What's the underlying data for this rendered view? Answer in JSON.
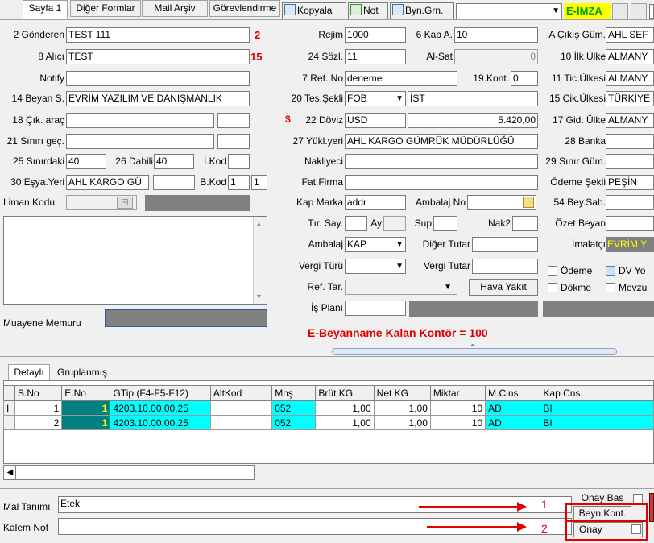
{
  "tabs": [
    "Sayfa 1",
    "Diğer Formlar",
    "Mail Arşiv",
    "Görevlendirme"
  ],
  "toolbar": {
    "kopyala": "Kopyala",
    "not": "Not",
    "byngrn": "Byn.Grn.",
    "eimza": "E-İMZA"
  },
  "colors": {
    "eimza_bg": "#ffff00",
    "eimza_fg": "#00a000",
    "red": "#e00000",
    "cyan": "#00ffff",
    "teal": "#008080"
  },
  "left": {
    "gonderen_label": "2 Gönderen",
    "gonderen_value": "TEST 111",
    "gonderen_num": "2",
    "alici_label": "8 Alıcı",
    "alici_value": "TEST",
    "alici_num": "15",
    "notify_label": "Notify",
    "beyan_label": "14 Beyan S.",
    "beyan_value": "EVRİM YAZILIM VE DANIŞMANLIK",
    "cik_arac_label": "18 Çık. araç",
    "sinir_gec_label": "21 Sınırı geç.",
    "sinirdaki_label": "25 Sınırdaki",
    "sinirdaki_value": "40",
    "dahili_label": "26 Dahili",
    "dahili_value": "40",
    "ikod_label": "İ.Kod",
    "esya_label": "30 Eşya.Yeri",
    "esya_value": "AHL KARGO GÜ",
    "bkod_label": "B.Kod",
    "bkod_value1": "1",
    "bkod_value2": "1",
    "liman_label": "Liman Kodu",
    "muayene_label": "Muayene Memuru"
  },
  "middle": {
    "rejim_label": "Rejim",
    "rejim_value": "1000",
    "kapa_label": "6 Kap A.",
    "kapa_value": "10",
    "sozl_label": "24 Sözl.",
    "sozl_value": "11",
    "alsat_label": "Al-Sat",
    "alsat_value": "0",
    "refno_label": "7 Ref. No",
    "refno_value": "deneme",
    "kont_label": "19.Kont.",
    "kont_value": "0",
    "tes_label": "20 Tes.Şekli",
    "tes_value": "FOB",
    "tes_value2": "İST",
    "doviz_label": "22 Döviz",
    "doviz_value": "USD",
    "doviz_amount": "5.420,00",
    "yukl_label": "27 Yükl.yeri",
    "yukl_value": "AHL KARGO GÜMRÜK MÜDÜRLÜĞÜ",
    "nakliyeci_label": "Nakliyeci",
    "fatfirma_label": "Fat.Firma",
    "kapmarka_label": "Kap Marka",
    "kapmarka_value": "addr",
    "ambalajno_label": "Ambalaj No",
    "tir_label": "Tır. Say.",
    "ay_label": "Ay",
    "sup_label": "Sup",
    "nak2_label": "Nak2",
    "ambalaj_label": "Ambalaj",
    "ambalaj_value": "KAP",
    "diger_tutar_label": "Diğer Tutar",
    "vergi_turu_label": "Vergi Türü",
    "vergi_tutar_label": "Vergi Tutar",
    "reftar_label": "Ref. Tar.",
    "hava_yakit": "Hava Yakıt",
    "isplani_label": "İş Planı",
    "ebeyanname": "E-Beyanname Kalan Kontör = 100"
  },
  "right": {
    "cikis_gum_label": "A Çıkış Güm.",
    "cikis_gum_value": "AHL SEF",
    "ilk_ulke_label": "10 İlk Ülke",
    "ilk_ulke_value": "ALMANY",
    "tic_ulke_label": "11 Tic.Ülkesi",
    "tic_ulke_value": "ALMANY",
    "cik_ulke_label": "15 Cik.Ülkesi",
    "cik_ulke_value": "TÜRKİYE",
    "gid_ulke_label": "17 Gid. Ülke",
    "gid_ulke_value": "ALMANY",
    "banka_label": "28 Banka",
    "sinir_gum_label": "29 Sınır Güm.",
    "odeme_label": "Ödeme Şekli",
    "odeme_value": "PEŞİN",
    "beysah_label": "54 Bey.Sah.",
    "ozet_label": "Özet Beyan",
    "imalatci_label": "İmalatçı",
    "imalatci_value": "EVRİM Y",
    "chk_odeme": "Ödeme",
    "chk_dv": "DV Yo",
    "chk_dokme": "Dökme",
    "chk_mevzu": "Mevzu"
  },
  "detail_tabs": [
    "Detaylı",
    "Gruplanmış"
  ],
  "grid": {
    "headers": [
      "S.No",
      "E.No",
      "GTip (F4-F5-F12)",
      "AltKod",
      "Mnş",
      "Brüt KG",
      "Net KG",
      "Miktar",
      "M.Cins",
      "Kap Cns."
    ],
    "rows": [
      [
        "1",
        "1",
        "4203.10.00.00.25",
        "",
        "052",
        "1,00",
        "1,00",
        "10",
        "AD",
        "BI"
      ],
      [
        "2",
        "1",
        "4203.10.00.00.25",
        "",
        "052",
        "1,00",
        "1,00",
        "10",
        "AD",
        "BI"
      ]
    ]
  },
  "bottom": {
    "mal_tanimi_label": "Mal Tanımı",
    "mal_tanimi_value": "Etek",
    "kalem_not_label": "Kalem Not",
    "onay_bas": "Onay Bas",
    "beyn_kont": "Beyn.Kont.",
    "onay": "Onay",
    "annot1": "1",
    "annot2": "2"
  }
}
